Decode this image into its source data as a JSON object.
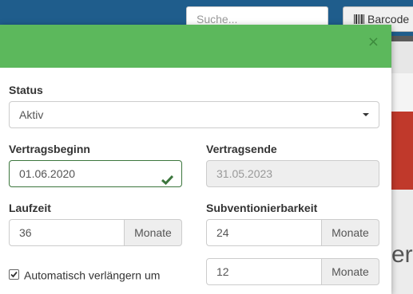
{
  "background": {
    "search_placeholder": "Suche...",
    "barcode_label": "Barcode",
    "partial_heading": "ert"
  },
  "modal": {
    "close_label": "×",
    "status": {
      "label": "Status",
      "value": "Aktiv"
    },
    "vertragsbeginn": {
      "label": "Vertragsbeginn",
      "value": "01.06.2020"
    },
    "vertragsende": {
      "label": "Vertragsende",
      "value": "31.05.2023"
    },
    "laufzeit": {
      "label": "Laufzeit",
      "value": "36",
      "unit": "Monate"
    },
    "subventionierbarkeit": {
      "label": "Subventionierbarkeit",
      "value": "24",
      "unit": "Monate"
    },
    "auto_renew": {
      "label": "Automatisch verlängern um",
      "checked": true,
      "value": "12",
      "unit": "Monate"
    }
  },
  "colors": {
    "header": "#5cb85c",
    "valid_border": "#3c763d",
    "topbar": "#1f5d8c"
  }
}
